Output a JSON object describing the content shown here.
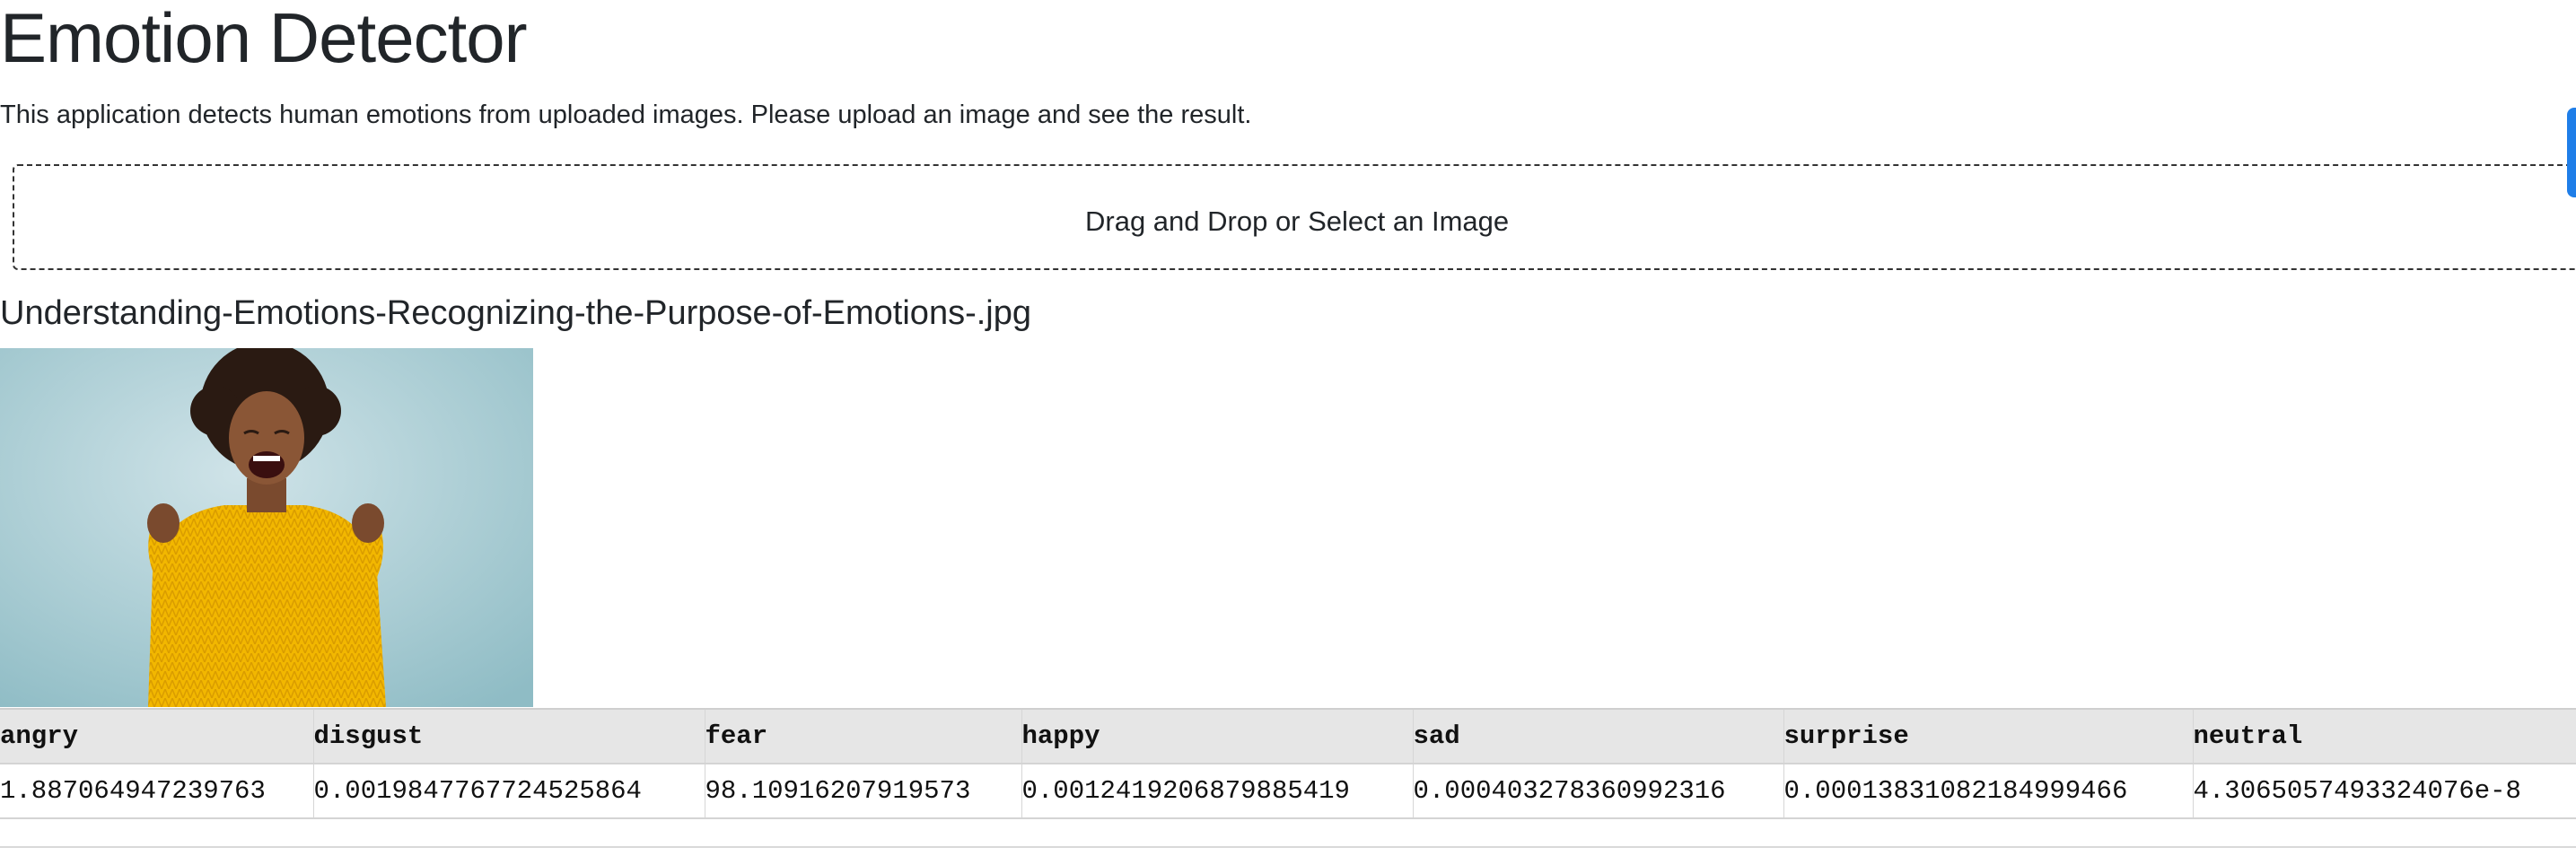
{
  "app": {
    "title": "Emotion Detector",
    "description": "This application detects human emotions from uploaded images. Please upload an image and see the result."
  },
  "upload": {
    "prompt": "Drag and Drop or Select an Image"
  },
  "result": {
    "filename": "Understanding-Emotions-Recognizing-the-Purpose-of-Emotions-.jpg",
    "image_icon": "uploaded-photo-person-cheering",
    "table": {
      "headers": [
        "angry",
        "disgust",
        "fear",
        "happy",
        "sad",
        "surprise",
        "neutral"
      ],
      "row": [
        "1.887064947239763",
        "0.0019847767724525864",
        "98.10916207919573",
        "0.0012419206879885419",
        "0.000403278360992316",
        "0.00013831082184999466",
        "4.3065057493324076e-8"
      ]
    }
  },
  "colors": {
    "accent": "#1f7ee8",
    "header_bg": "#e6e6e6",
    "text": "#212529"
  }
}
